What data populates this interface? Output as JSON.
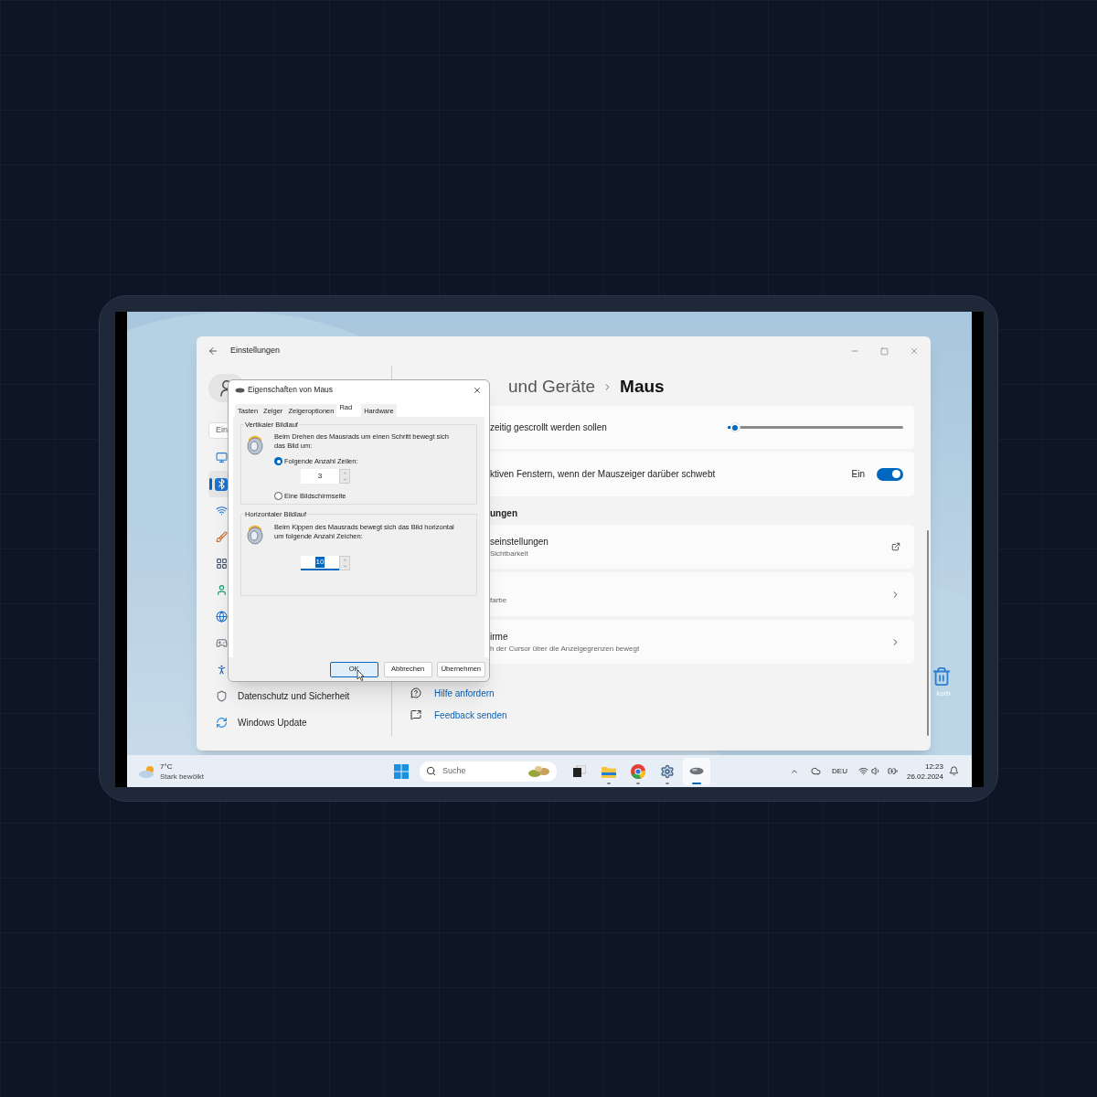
{
  "settings": {
    "title": "Einstellungen",
    "search_value": "Ein",
    "sidebar": [
      {
        "selected": false
      },
      {
        "selected": true
      },
      {
        "selected": false
      },
      {
        "selected": false
      },
      {
        "selected": false
      },
      {
        "selected": false
      },
      {
        "selected": false
      },
      {
        "selected": false
      },
      {
        "selected": false
      },
      {
        "label": "Datenschutz und Sicherheit",
        "selected": false
      },
      {
        "label": "Windows Update",
        "selected": false
      }
    ],
    "breadcrumb": {
      "parent": "und Geräte",
      "current": "Maus"
    },
    "cards": [
      {
        "kind": "slider",
        "title": "zeitig gescrollt werden sollen",
        "level": 0.04
      },
      {
        "kind": "toggle",
        "title": "ktiven Fenstern, wenn der Mauszeiger darüber schwebt",
        "state_label": "Ein",
        "on": true
      }
    ],
    "section_heading": "ungen",
    "link_cards": [
      {
        "kind": "external",
        "title": "seinstellungen",
        "subtitle": "Sichtbarkeit"
      },
      {
        "kind": "chevron",
        "subtitle": "farbe"
      },
      {
        "kind": "chevron",
        "title": "irme",
        "subtitle": "h der Cursor über die Anzeigegrenzen bewegt"
      }
    ],
    "help_links": [
      "Hilfe anfordern",
      "Feedback senden"
    ]
  },
  "dialog": {
    "title": "Eigenschaften von Maus",
    "tabs": [
      {
        "label": "Tasten",
        "selected": false
      },
      {
        "label": "Zeiger",
        "selected": false
      },
      {
        "label": "Zeigeroptionen",
        "selected": false
      },
      {
        "label": "Rad",
        "selected": true
      },
      {
        "label": "Hardware",
        "selected": false
      }
    ],
    "vertical": {
      "legend": "Vertikaler Bildlauf",
      "text": "Beim Drehen des Mausrads um einen Schritt bewegt sich das Bild um:",
      "options": [
        {
          "label": "Folgende Anzahl Zeilen:",
          "selected": true,
          "value": "3"
        },
        {
          "label": "Eine Bildschirmseite",
          "selected": false
        }
      ]
    },
    "horizontal": {
      "legend": "Horizontaler Bildlauf",
      "text": "Beim Kippen des Mausrads bewegt sich das Bild horizontal um folgende Anzahl Zeichen:",
      "value": "10"
    },
    "buttons": [
      {
        "label": "OK",
        "default": true
      },
      {
        "label": "Abbrechen",
        "default": false
      },
      {
        "label": "Übernehmen",
        "default": false
      }
    ]
  },
  "desktop_icon": {
    "label": "korb"
  },
  "taskbar": {
    "temperature": "7°C",
    "weather": "Stark bewölkt",
    "search_placeholder": "Suche",
    "apps": [
      {
        "running": false,
        "active": false
      },
      {
        "running": true,
        "active": false
      },
      {
        "running": true,
        "active": false
      },
      {
        "running": true,
        "active": false
      },
      {
        "running": true,
        "active": true
      }
    ],
    "language": "DEU",
    "time": "12:23",
    "date": "26.02.2024"
  }
}
